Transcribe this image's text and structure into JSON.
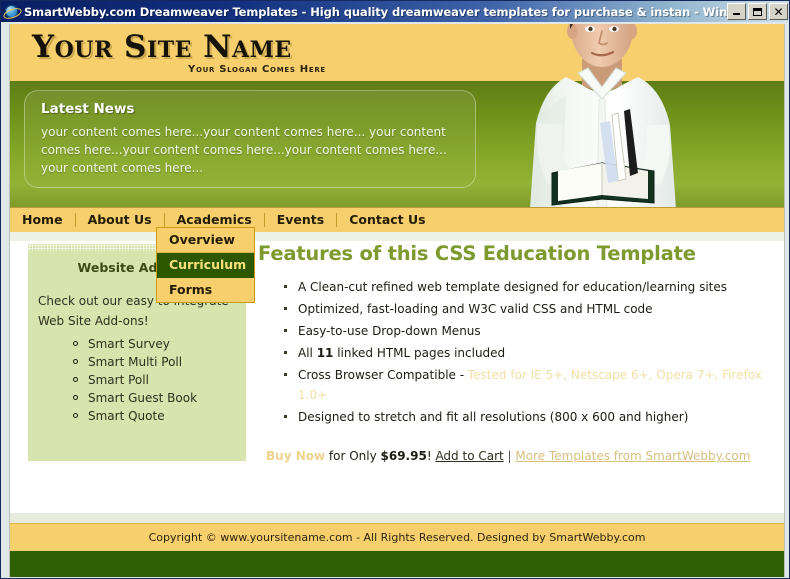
{
  "browser": {
    "title": "SmartWebby.com Dreamweaver Templates - High quality dreamweaver templates for purchase & instan - Windows Interne..",
    "icon": "internet-explorer-icon",
    "minimize_label": "_",
    "maximize_label": "□",
    "close_label": "✕"
  },
  "header": {
    "site_name": "Your Site Name",
    "slogan": "Your Slogan Comes Here",
    "photo_alt": "young-man-holding-open-book"
  },
  "news": {
    "title": "Latest News",
    "body": "your content comes here...your content comes here... your content comes here...your content comes here...your content comes here... your content comes here..."
  },
  "nav": {
    "items": [
      {
        "label": "Home"
      },
      {
        "label": "About Us"
      },
      {
        "label": "Academics"
      },
      {
        "label": "Events"
      },
      {
        "label": "Contact Us"
      }
    ]
  },
  "dropdown": {
    "parent": "Academics",
    "items": [
      {
        "label": "Overview",
        "active": false
      },
      {
        "label": "Curriculum",
        "active": true
      },
      {
        "label": "Forms",
        "active": false
      }
    ]
  },
  "sidebar": {
    "title": "Website Add-ons",
    "intro": "Check out our easy to integrate Web Site Add-ons!",
    "items": [
      {
        "label": "Smart Survey"
      },
      {
        "label": "Smart Multi Poll"
      },
      {
        "label": "Smart Poll"
      },
      {
        "label": "Smart Guest Book"
      },
      {
        "label": "Smart Quote"
      }
    ]
  },
  "main": {
    "heading": "Features of this CSS Education Template",
    "features": [
      {
        "text": "A Clean-cut refined web template designed for education/learning sites"
      },
      {
        "text": "Optimized, fast-loading and W3C valid CSS and HTML code"
      },
      {
        "text": "Easy-to-use Drop-down Menus"
      },
      {
        "text_before": "All ",
        "strong": "11",
        "text_after": " linked HTML pages included"
      },
      {
        "text_before": "Cross Browser Compatible - ",
        "muted": "Tested for IE 5+, Netscape 6+, Opera 7+, Firefox 1.0+"
      },
      {
        "text": "Designed to stretch and fit all resolutions (800 x 600 and higher)"
      }
    ],
    "buy": {
      "buy_now": "Buy Now",
      "for_only": " for Only ",
      "price": "$69.95",
      "exclaim": "! ",
      "add_to_cart": "Add to Cart",
      "separator": " | ",
      "more_templates": "More Templates from SmartWebby.com"
    }
  },
  "footer": {
    "copyright": "Copyright © www.yoursitename.com - All Rights Reserved. Designed by SmartWebby.com"
  },
  "colors": {
    "gold": "#f7cf6d",
    "green_dark": "#2f6006",
    "green_mid": "#7e9a2e",
    "sidebar_bg": "#d7e4ad",
    "dropdown_active_bg": "#2d5800",
    "dropdown_active_text": "#f6e27a",
    "titlebar_blue": "#0a1f63"
  }
}
